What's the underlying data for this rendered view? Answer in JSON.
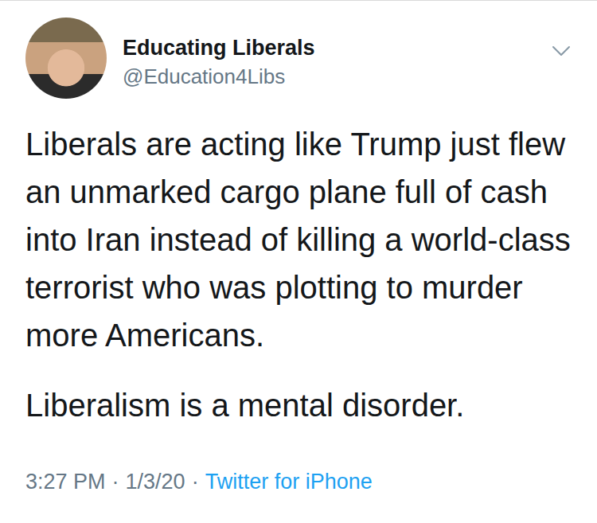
{
  "account": {
    "name": "Educating Liberals",
    "handle": "@Education4Libs"
  },
  "tweet": {
    "paragraphs": [
      "Liberals are acting like Trump just flew an unmarked cargo plane full of cash into Iran instead of killing a world-class terrorist who was plotting to murder more Americans.",
      "Liberalism is a mental disorder."
    ]
  },
  "meta": {
    "time": "3:27 PM",
    "separator": "·",
    "date": "1/3/20",
    "source": "Twitter for iPhone"
  }
}
